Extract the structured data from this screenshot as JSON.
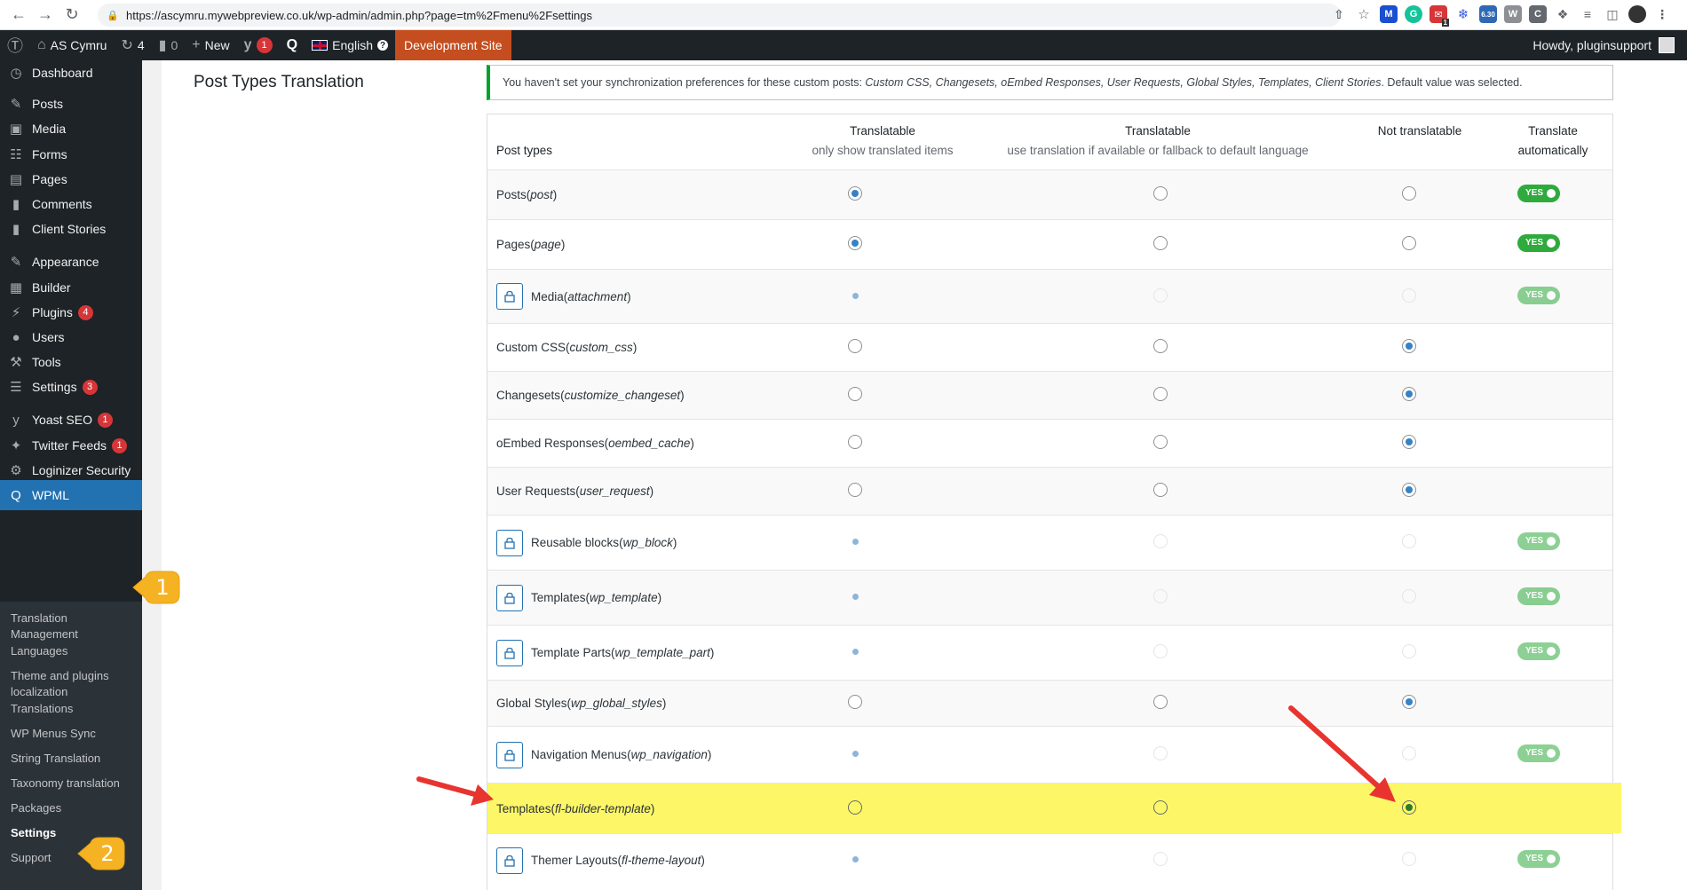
{
  "browser": {
    "url": "https://ascymru.mywebpreview.co.uk/wp-admin/admin.php?page=tm%2Fmenu%2Fsettings",
    "extension_badge": "6.30",
    "extension_count": "1"
  },
  "adminbar": {
    "site_name": "AS Cymru",
    "updates_count": "4",
    "comments_count": "0",
    "new_label": "New",
    "yoast_count": "1",
    "language": "English",
    "dev_site": "Development Site",
    "howdy": "Howdy, pluginsupport"
  },
  "sidebar": {
    "items": [
      {
        "label": "Dashboard",
        "icon": "dashboard-icon"
      },
      {
        "label": "Posts",
        "icon": "pin-icon"
      },
      {
        "label": "Media",
        "icon": "media-icon"
      },
      {
        "label": "Forms",
        "icon": "forms-icon"
      },
      {
        "label": "Pages",
        "icon": "pages-icon"
      },
      {
        "label": "Comments",
        "icon": "comment-icon"
      },
      {
        "label": "Client Stories",
        "icon": "comment-icon"
      },
      {
        "label": "Appearance",
        "icon": "brush-icon"
      },
      {
        "label": "Builder",
        "icon": "grid-icon"
      },
      {
        "label": "Plugins",
        "icon": "plug-icon",
        "badge": "4"
      },
      {
        "label": "Users",
        "icon": "user-icon"
      },
      {
        "label": "Tools",
        "icon": "wrench-icon"
      },
      {
        "label": "Settings",
        "icon": "sliders-icon",
        "badge": "3"
      },
      {
        "label": "Yoast SEO",
        "icon": "yoast-icon",
        "badge": "1"
      },
      {
        "label": "Twitter Feeds",
        "icon": "twitter-icon",
        "badge": "1"
      },
      {
        "label": "Loginizer Security",
        "icon": "gear-icon"
      },
      {
        "label": "WPML",
        "icon": "wpml-icon"
      }
    ],
    "submenu": [
      "Translation Management",
      "Languages",
      "Theme and plugins localization",
      "Translations",
      "WP Menus Sync",
      "String Translation",
      "Taxonomy translation",
      "Packages",
      "Settings",
      "Support"
    ]
  },
  "callouts": [
    "1",
    "2"
  ],
  "section_title": "Post Types Translation",
  "notice": {
    "text_before": "You haven't set your synchronization preferences for these custom posts: ",
    "list": "Custom CSS, Changesets, oEmbed Responses, User Requests, Global Styles, Templates, Client Stories",
    "text_after": ". Default value was selected."
  },
  "table": {
    "headers": {
      "post_types": "Post types",
      "translatable_only_title": "Translatable",
      "translatable_only_sub": "only show translated items",
      "translatable_fallback_title": "Translatable",
      "translatable_fallback_sub": "use translation if available or fallback to default language",
      "not_translatable": "Not translatable",
      "auto_title": "Translate",
      "auto_sub": "automatically"
    },
    "toggle_label": "YES",
    "rows": [
      {
        "name": "Posts",
        "slug": "post",
        "locked": false,
        "selected": 0,
        "toggle": true
      },
      {
        "name": "Pages",
        "slug": "page",
        "locked": false,
        "selected": 0,
        "toggle": true
      },
      {
        "name": "Media",
        "slug": "attachment",
        "locked": true,
        "selected": 0,
        "toggle": true
      },
      {
        "name": "Custom CSS",
        "slug": "custom_css",
        "locked": false,
        "selected": 2,
        "toggle": false
      },
      {
        "name": "Changesets",
        "slug": "customize_changeset",
        "locked": false,
        "selected": 2,
        "toggle": false
      },
      {
        "name": "oEmbed Responses",
        "slug": "oembed_cache",
        "locked": false,
        "selected": 2,
        "toggle": false
      },
      {
        "name": "User Requests",
        "slug": "user_request",
        "locked": false,
        "selected": 2,
        "toggle": false
      },
      {
        "name": "Reusable blocks",
        "slug": "wp_block",
        "locked": true,
        "selected": 0,
        "toggle": true
      },
      {
        "name": "Templates",
        "slug": "wp_template",
        "locked": true,
        "selected": 0,
        "toggle": true
      },
      {
        "name": "Template Parts",
        "slug": "wp_template_part",
        "locked": true,
        "selected": 0,
        "toggle": true
      },
      {
        "name": "Global Styles",
        "slug": "wp_global_styles",
        "locked": false,
        "selected": 2,
        "toggle": false
      },
      {
        "name": "Navigation Menus",
        "slug": "wp_navigation",
        "locked": true,
        "selected": 0,
        "toggle": true
      },
      {
        "name": "Templates",
        "slug": "fl-builder-template",
        "locked": false,
        "selected": 2,
        "toggle": false,
        "highlight": true
      },
      {
        "name": "Themer Layouts",
        "slug": "fl-theme-layout",
        "locked": true,
        "selected": 0,
        "toggle": true
      }
    ]
  },
  "colors": {
    "admin_bar": "#1d2327",
    "active_menu": "#2271b1",
    "dev_badge": "#c44e1f",
    "highlight": "#fdf767",
    "toggle_on": "#2faa3d",
    "callout": "#f5b324",
    "arrow": "#e8342f"
  }
}
